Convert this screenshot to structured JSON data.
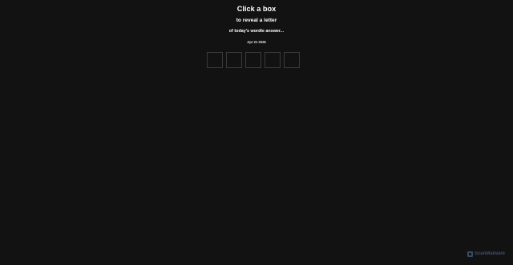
{
  "header": {
    "title": "Click a box",
    "subtitle": "to reveal a letter",
    "caption": "of today's wordle answer...",
    "date": "Apr 21 2026"
  },
  "boxes": {
    "count": 5,
    "border_color": "#3a3a3c"
  },
  "background_color": "#121213",
  "watermark": {
    "text": "ScanMalware",
    "icon": "scanmalware-logo-icon"
  }
}
